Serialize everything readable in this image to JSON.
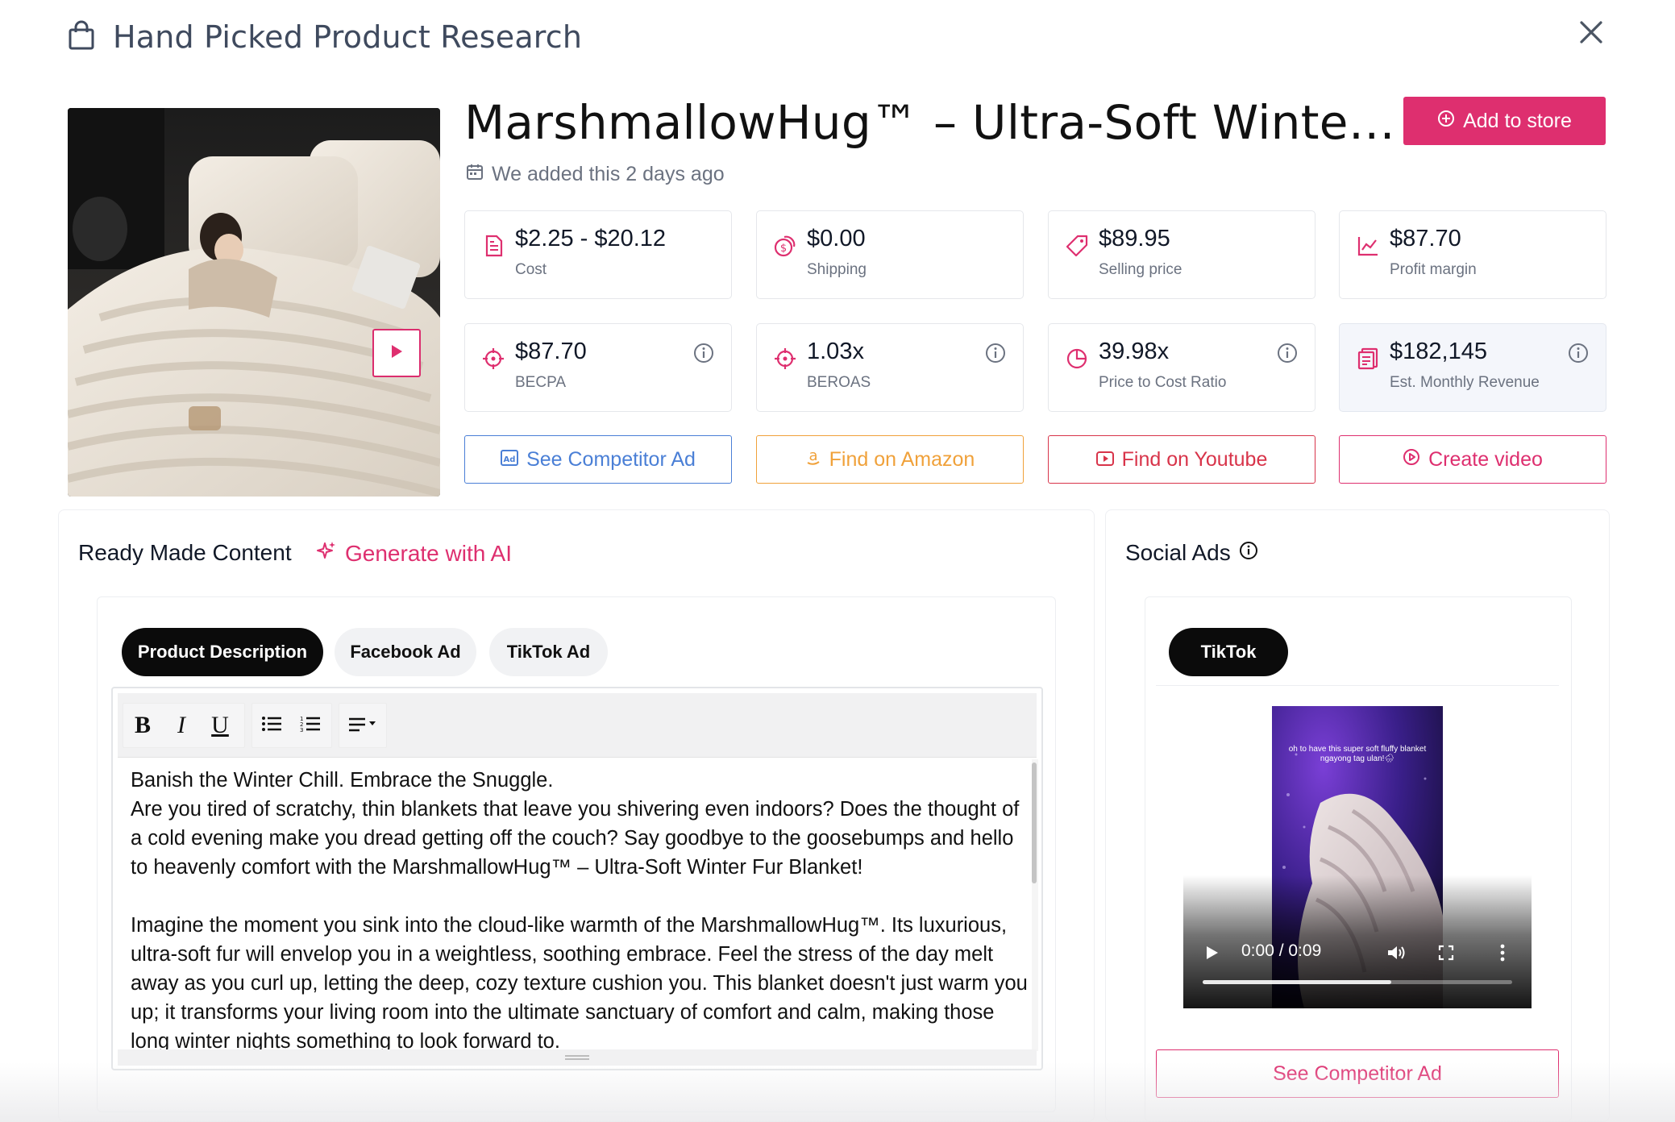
{
  "header": {
    "title": "Hand Picked Product Research"
  },
  "product": {
    "title": "MarshmallowHug™ – Ultra-Soft Winte…",
    "added_text": "We added this 2 days ago"
  },
  "add_to_store_label": "Add to store",
  "metrics": [
    {
      "value": "$2.25 - $20.12",
      "label": "Cost",
      "icon": "document-icon"
    },
    {
      "value": "$0.00",
      "label": "Shipping",
      "icon": "coins-icon"
    },
    {
      "value": "$89.95",
      "label": "Selling price",
      "icon": "tag-icon"
    },
    {
      "value": "$87.70",
      "label": "Profit margin",
      "icon": "line-chart-icon"
    },
    {
      "value": "$87.70",
      "label": "BECPA",
      "icon": "crosshair-icon"
    },
    {
      "value": "1.03x",
      "label": "BEROAS",
      "icon": "crosshair-icon"
    },
    {
      "value": "39.98x",
      "label": "Price to Cost Ratio",
      "icon": "pie-chart-icon"
    },
    {
      "value": "$182,145",
      "label": "Est. Monthly Revenue",
      "icon": "receipt-icon"
    }
  ],
  "actions": {
    "competitor_ad": "See Competitor Ad",
    "amazon": "Find on Amazon",
    "youtube": "Find on Youtube",
    "create_video": "Create video"
  },
  "content": {
    "title": "Ready Made Content",
    "generate_ai": "Generate with AI",
    "tabs": [
      "Product Description",
      "Facebook Ad",
      "TikTok Ad"
    ],
    "toolbar": {
      "bold": "B",
      "italic": "I",
      "underline": "U"
    },
    "text": {
      "p1": "Banish the Winter Chill. Embrace the Snuggle.",
      "p2": "Are you tired of scratchy, thin blankets that leave you shivering even indoors? Does the thought of a cold evening make you dread getting off the couch? Say goodbye to the goosebumps and hello to heavenly comfort with the MarshmallowHug™ – Ultra-Soft Winter Fur Blanket!",
      "p3": "Imagine the moment you sink into the cloud-like warmth of the MarshmallowHug™. Its luxurious, ultra-soft fur will envelop you in a weightless, soothing embrace. Feel the stress of the day melt away as you curl up, letting the deep, cozy texture cushion you. This blanket doesn't just warm you up; it transforms your living room into the ultimate sanctuary of comfort and calm, making those long winter nights something to look forward to."
    }
  },
  "social": {
    "title": "Social Ads",
    "tab": "TikTok",
    "video_time": "0:00 / 0:09",
    "video_caption": "oh to have this super soft fluffy blanket ngayong tag ulan!🌧",
    "progress": 0.61,
    "competitor_ad": "See Competitor Ad"
  },
  "colors": {
    "accent": "#de2f6f",
    "blue": "#4a7fd6",
    "amazon": "#f0a13a",
    "youtube": "#d8344a"
  }
}
